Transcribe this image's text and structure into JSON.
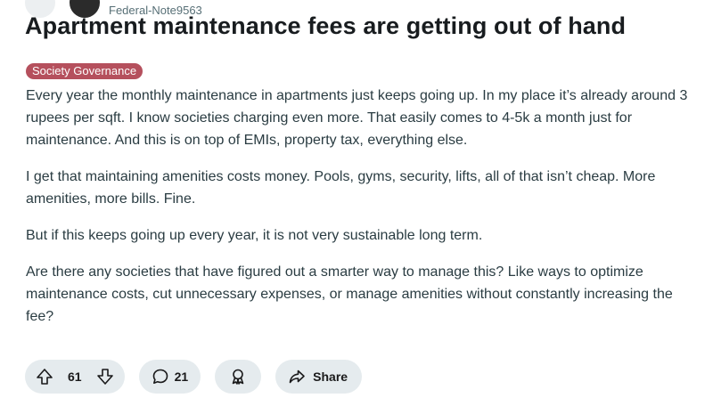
{
  "post": {
    "author": "Federal-Note9563",
    "title": "Apartment maintenance fees are getting out of hand",
    "flair": "Society Governance",
    "paragraphs": [
      "Every year the monthly maintenance in apartments just keeps going up. In my place it’s already around 3 rupees per sqft. I know societies charging even more. That easily comes to 4-5k a month just for maintenance. And this is on top of EMIs, property tax, everything else.",
      "I get that maintaining amenities costs money. Pools, gyms, security, lifts, all of that isn’t cheap. More amenities, more bills. Fine.",
      "But if this keeps going up every year, it is not very sustainable long term.",
      "Are there any societies that have figured out a smarter way to manage this? Like ways to optimize maintenance costs, cut unnecessary expenses, or manage amenities without constantly increasing the fee?"
    ]
  },
  "actions": {
    "vote_count": "61",
    "comment_count": "21",
    "share_label": "Share",
    "icons": {
      "upvote": "upvote-arrow-icon",
      "downvote": "downvote-arrow-icon",
      "comment": "comment-bubble-icon",
      "award": "award-ribbon-icon",
      "share": "share-arrow-icon"
    }
  },
  "colors": {
    "flair_bg": "#b5505d",
    "pill_bg": "#e5ebee",
    "title": "#181c1f",
    "body_text": "#2a3c42"
  }
}
